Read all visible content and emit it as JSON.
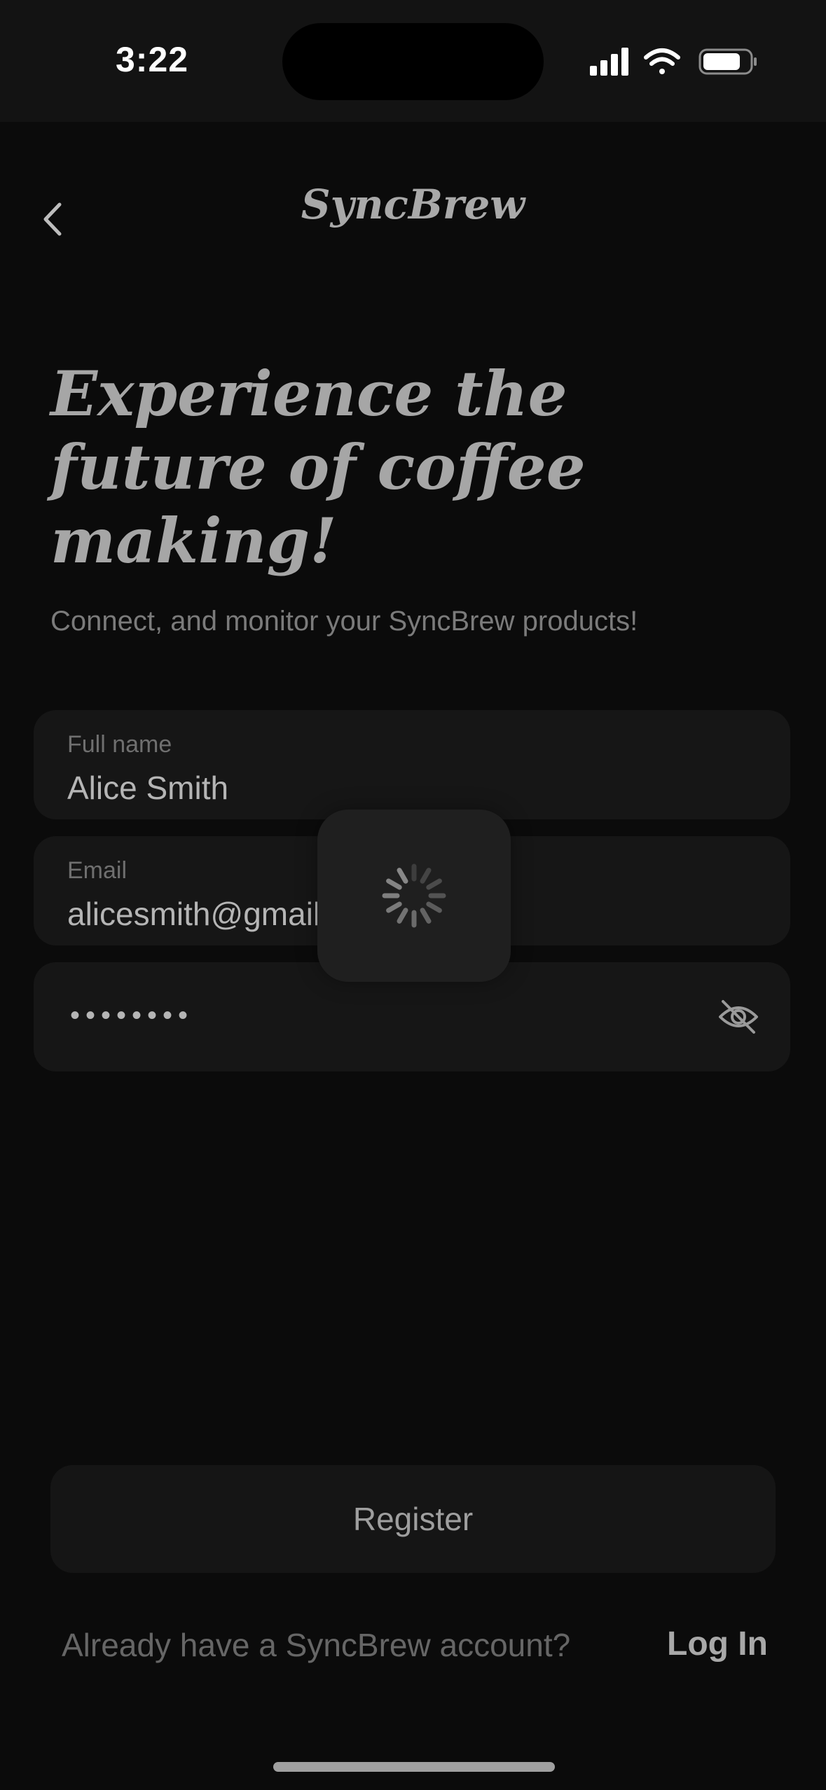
{
  "status_bar": {
    "time": "3:22"
  },
  "header": {
    "brand": "SyncBrew"
  },
  "hero": {
    "headline": "Experience the future of coffee making!",
    "subtitle": "Connect, and monitor your SyncBrew products!"
  },
  "form": {
    "full_name": {
      "label": "Full name",
      "value": "Alice Smith"
    },
    "email": {
      "label": "Email",
      "value": "alicesmith@gmail.com"
    },
    "password": {
      "value": "••••••••"
    }
  },
  "actions": {
    "register_label": "Register",
    "footer_question": "Already have a SyncBrew account?",
    "login_label": "Log In"
  },
  "icons": {
    "back": "chevron-left-icon",
    "password_toggle": "eye-off-icon",
    "loading": "spinner-icon",
    "signal": "cellular-signal-icon",
    "wifi": "wifi-icon",
    "battery": "battery-icon"
  }
}
